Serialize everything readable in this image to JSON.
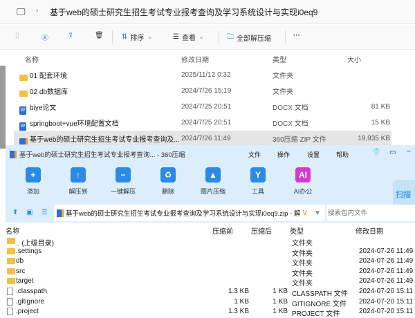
{
  "explorer": {
    "breadcrumb": "基于web的硕士研究生招生考试专业报考查询及学习系统设计与实现i0eq9",
    "toolbar": {
      "sort": "排序",
      "view": "查看",
      "extract_all": "全部解压缩",
      "more": "···"
    },
    "columns": [
      "名称",
      "修改日期",
      "类型",
      "大小"
    ],
    "rows": [
      {
        "name": "01 配套环境",
        "date": "2025/11/12 0:32",
        "type": "文件夹",
        "size": "",
        "icon": "folder"
      },
      {
        "name": "02 db数据库",
        "date": "2024/7/26 15:19",
        "type": "文件夹",
        "size": "",
        "icon": "folder"
      },
      {
        "name": "biye论文",
        "date": "2024/7/25 20:51",
        "type": "DOCX 文档",
        "size": "81 KB",
        "icon": "word"
      },
      {
        "name": "springboot+vue环境配置文档",
        "date": "2024/7/25 20:51",
        "type": "DOCX 文档",
        "size": "15 KB",
        "icon": "word"
      },
      {
        "name": "基于web的硕士研究生招生考试专业报考查询及...",
        "date": "2024/7/26 11:49",
        "type": "360压缩 ZIP 文件",
        "size": "19,935 KB",
        "icon": "zip"
      }
    ]
  },
  "zip": {
    "title": "基于web的硕士研究生招生考试专业报考查询... - 360压缩",
    "menu": [
      "文件",
      "操作",
      "设置",
      "帮助"
    ],
    "tools": [
      "添加",
      "解压到",
      "一键解压",
      "删除",
      "图片压缩",
      "工具",
      "AI办公"
    ],
    "scan": "扫描",
    "path": "基于web的硕士研究生招生考试专业报考查询及学习系统设计与实现i0eq9.zip - 解",
    "search_placeholder": "搜索包内文件",
    "columns": [
      "名称",
      "压缩前",
      "压缩后",
      "类型",
      "修改日期"
    ],
    "rows": [
      {
        "name": ".. (上级目录)",
        "before": "",
        "after": "",
        "type": "文件夹",
        "date": "",
        "icon": "folder"
      },
      {
        "name": ".settings",
        "before": "",
        "after": "",
        "type": "文件夹",
        "date": "2024-07-26 11:49",
        "icon": "folder"
      },
      {
        "name": "db",
        "before": "",
        "after": "",
        "type": "文件夹",
        "date": "2024-07-26 11:49",
        "icon": "folder"
      },
      {
        "name": "src",
        "before": "",
        "after": "",
        "type": "文件夹",
        "date": "2024-07-26 11:49",
        "icon": "folder"
      },
      {
        "name": "target",
        "before": "",
        "after": "",
        "type": "文件夹",
        "date": "2024-07-26 11:49",
        "icon": "folder"
      },
      {
        "name": ".classpath",
        "before": "1.3 KB",
        "after": "1 KB",
        "type": "CLASSPATH 文件",
        "date": "2024-07-20 15:11",
        "icon": "file"
      },
      {
        "name": ".gitignore",
        "before": "1 KB",
        "after": "1 KB",
        "type": "GITIGNORE 文件",
        "date": "2024-07-20 15:11",
        "icon": "file"
      },
      {
        "name": ".project",
        "before": "1.3 KB",
        "after": "1 KB",
        "type": "PROJECT 文件",
        "date": "2024-07-20 15:11",
        "icon": "file"
      }
    ]
  }
}
